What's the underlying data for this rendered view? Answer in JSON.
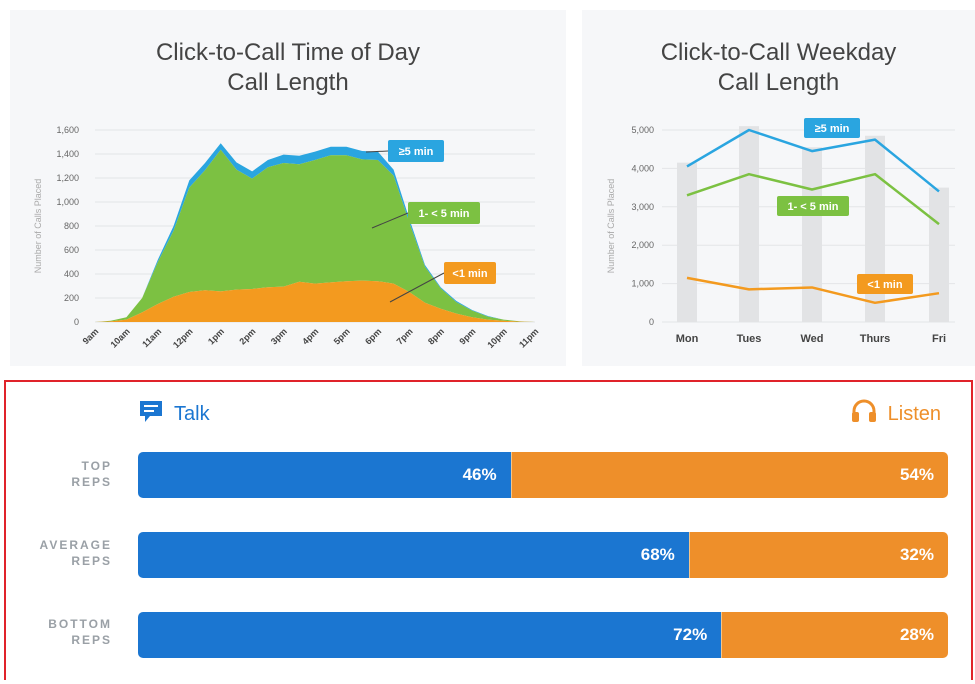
{
  "chart_data": [
    {
      "type": "area",
      "title": "Click-to-Call Time of Day\nCall Length",
      "title_lines": [
        "Click-to-Call Time of Day",
        "Call Length"
      ],
      "ylabel": "Number of Calls Placed",
      "ylim": [
        0,
        1600
      ],
      "yticks": [
        "0",
        "200",
        "400",
        "600",
        "800",
        "1,000",
        "1,200",
        "1,400",
        "1,600"
      ],
      "ytick_values": [
        0,
        200,
        400,
        600,
        800,
        1000,
        1200,
        1400,
        1600
      ],
      "categories": [
        "9am",
        "10am",
        "11am",
        "12pm",
        "1pm",
        "2pm",
        "3pm",
        "4pm",
        "5pm",
        "6pm",
        "7pm",
        "8pm",
        "9pm",
        "10pm",
        "11pm"
      ],
      "x": [
        0,
        0.5,
        1,
        1.5,
        2,
        2.5,
        3,
        3.5,
        4,
        4.5,
        5,
        5.5,
        6,
        6.5,
        7,
        7.5,
        8,
        8.5,
        9,
        9.5,
        10,
        10.5,
        11,
        11.5,
        12,
        12.5,
        13,
        13.5,
        14
      ],
      "series": [
        {
          "name": "<1 min",
          "color": "#f39a1f",
          "values": [
            0,
            5,
            20,
            80,
            150,
            210,
            250,
            265,
            255,
            270,
            275,
            290,
            295,
            335,
            320,
            330,
            340,
            345,
            340,
            320,
            250,
            160,
            110,
            70,
            40,
            20,
            10,
            3,
            0
          ]
        },
        {
          "name": "1- < 5 min",
          "color": "#7cc142",
          "values": [
            0,
            5,
            20,
            120,
            350,
            550,
            870,
            1000,
            1180,
            1000,
            920,
            1000,
            1030,
            980,
            1030,
            1060,
            1050,
            1010,
            1010,
            900,
            580,
            300,
            170,
            95,
            55,
            25,
            10,
            3,
            0
          ]
        },
        {
          "name": "≥5 min",
          "color": "#2aa5e0",
          "values": [
            0,
            0,
            0,
            0,
            20,
            40,
            60,
            60,
            55,
            60,
            60,
            60,
            70,
            70,
            70,
            70,
            70,
            70,
            70,
            50,
            30,
            15,
            10,
            10,
            5,
            5,
            0,
            0,
            0
          ]
        }
      ],
      "annotations": [
        "≥5 min",
        "1- < 5 min",
        "<1 min"
      ],
      "grid": true
    },
    {
      "type": "line",
      "title": "Click-to-Call Weekday\nCall Length",
      "title_lines": [
        "Click-to-Call Weekday",
        "Call Length"
      ],
      "ylabel": "Number of Calls Placed",
      "ylim": [
        0,
        5000
      ],
      "yticks": [
        "0",
        "1,000",
        "2,000",
        "3,000",
        "4,000",
        "5,000"
      ],
      "ytick_values": [
        0,
        1000,
        2000,
        3000,
        4000,
        5000
      ],
      "categories": [
        "Mon",
        "Tues",
        "Wed",
        "Thurs",
        "Fri"
      ],
      "totals": [
        4150,
        5100,
        4550,
        4850,
        3500
      ],
      "series": [
        {
          "name": "≥5 min",
          "color": "#2aa5e0",
          "values": [
            4050,
            5000,
            4450,
            4750,
            3400
          ]
        },
        {
          "name": "1- < 5 min",
          "color": "#7cc142",
          "values": [
            3300,
            3850,
            3450,
            3850,
            2550
          ]
        },
        {
          "name": "<1 min",
          "color": "#f39a1f",
          "values": [
            1150,
            850,
            900,
            500,
            750
          ]
        }
      ],
      "annotations": [
        "≥5 min",
        "1- < 5 min",
        "<1 min"
      ],
      "grid": true
    },
    {
      "type": "bar",
      "orientation": "horizontal-stacked",
      "legend": {
        "talk": "Talk",
        "listen": "Listen"
      },
      "categories": [
        [
          "TOP",
          "REPS"
        ],
        [
          "AVERAGE",
          "REPS"
        ],
        [
          "BOTTOM",
          "REPS"
        ]
      ],
      "series": [
        {
          "name": "Talk",
          "color": "#1b76d1",
          "values": [
            46,
            68,
            72
          ],
          "labels": [
            "46%",
            "68%",
            "72%"
          ]
        },
        {
          "name": "Listen",
          "color": "#ee8f2a",
          "values": [
            54,
            32,
            28
          ],
          "labels": [
            "54%",
            "32%",
            "28%"
          ]
        }
      ]
    }
  ]
}
